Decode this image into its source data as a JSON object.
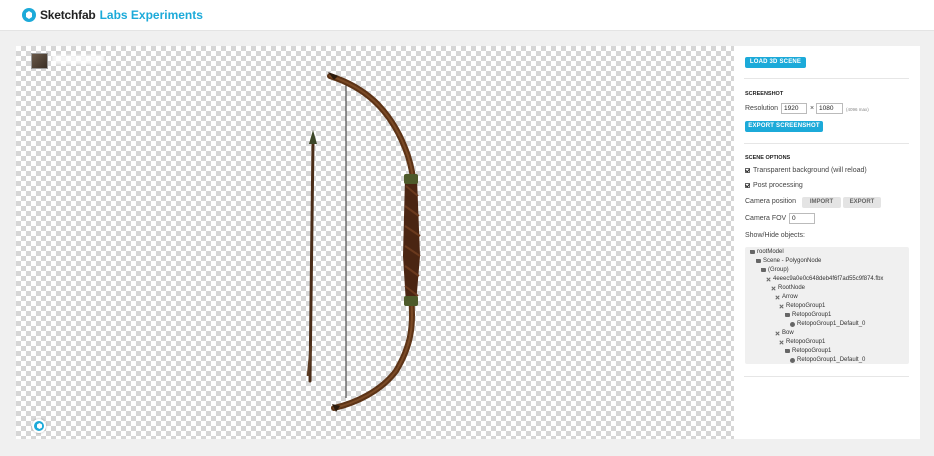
{
  "header": {
    "brand": "Sketchfab",
    "subtitle": "Labs Experiments"
  },
  "viewer": {
    "model_thumbnail": "model-thumbnail",
    "icons": {
      "sketchfab": "sketchfab-logo-icon"
    }
  },
  "panel": {
    "load_button": "LOAD 3D SCENE",
    "screenshot": {
      "title": "SCREENSHOT",
      "resolution_label": "Resolution",
      "width": "1920",
      "times": "×",
      "height": "1080",
      "max_hint": "(4096 max)",
      "export_button": "EXPORT SCREENSHOT"
    },
    "scene_options": {
      "title": "SCENE OPTIONS",
      "transparent_bg": "Transparent background (will reload)",
      "post_processing": "Post processing",
      "camera_position_label": "Camera position",
      "import_button": "IMPORT",
      "export_button": "EXPORT",
      "camera_fov_label": "Camera FOV",
      "camera_fov_value": "0",
      "show_hide_label": "Show/Hide objects:"
    },
    "tree": [
      {
        "label": "rootModel",
        "icon": "folder-icon",
        "depth": 0
      },
      {
        "label": "Scene - PolygonNode",
        "icon": "folder-icon",
        "depth": 1
      },
      {
        "label": "(Group)",
        "icon": "folder-icon",
        "depth": 2
      },
      {
        "label": "4eeec9a0e0c648deb4f6f7ad55c9f874.fbx",
        "icon": "bone-icon",
        "depth": 3
      },
      {
        "label": "RootNode",
        "icon": "bone-icon",
        "depth": 4
      },
      {
        "label": "Arrow",
        "icon": "bone-icon",
        "depth": 5
      },
      {
        "label": "RetopoGroup1",
        "icon": "bone-icon",
        "depth": 6
      },
      {
        "label": "RetopoGroup1",
        "icon": "folder-icon",
        "depth": 7
      },
      {
        "label": "RetopoGroup1_Default_0",
        "icon": "mesh-icon",
        "depth": 8
      },
      {
        "label": "Bow",
        "icon": "bone-icon",
        "depth": 5
      },
      {
        "label": "RetopoGroup1",
        "icon": "bone-icon",
        "depth": 6
      },
      {
        "label": "RetopoGroup1",
        "icon": "folder-icon",
        "depth": 7
      },
      {
        "label": "RetopoGroup1_Default_0",
        "icon": "mesh-icon",
        "depth": 8
      }
    ]
  }
}
